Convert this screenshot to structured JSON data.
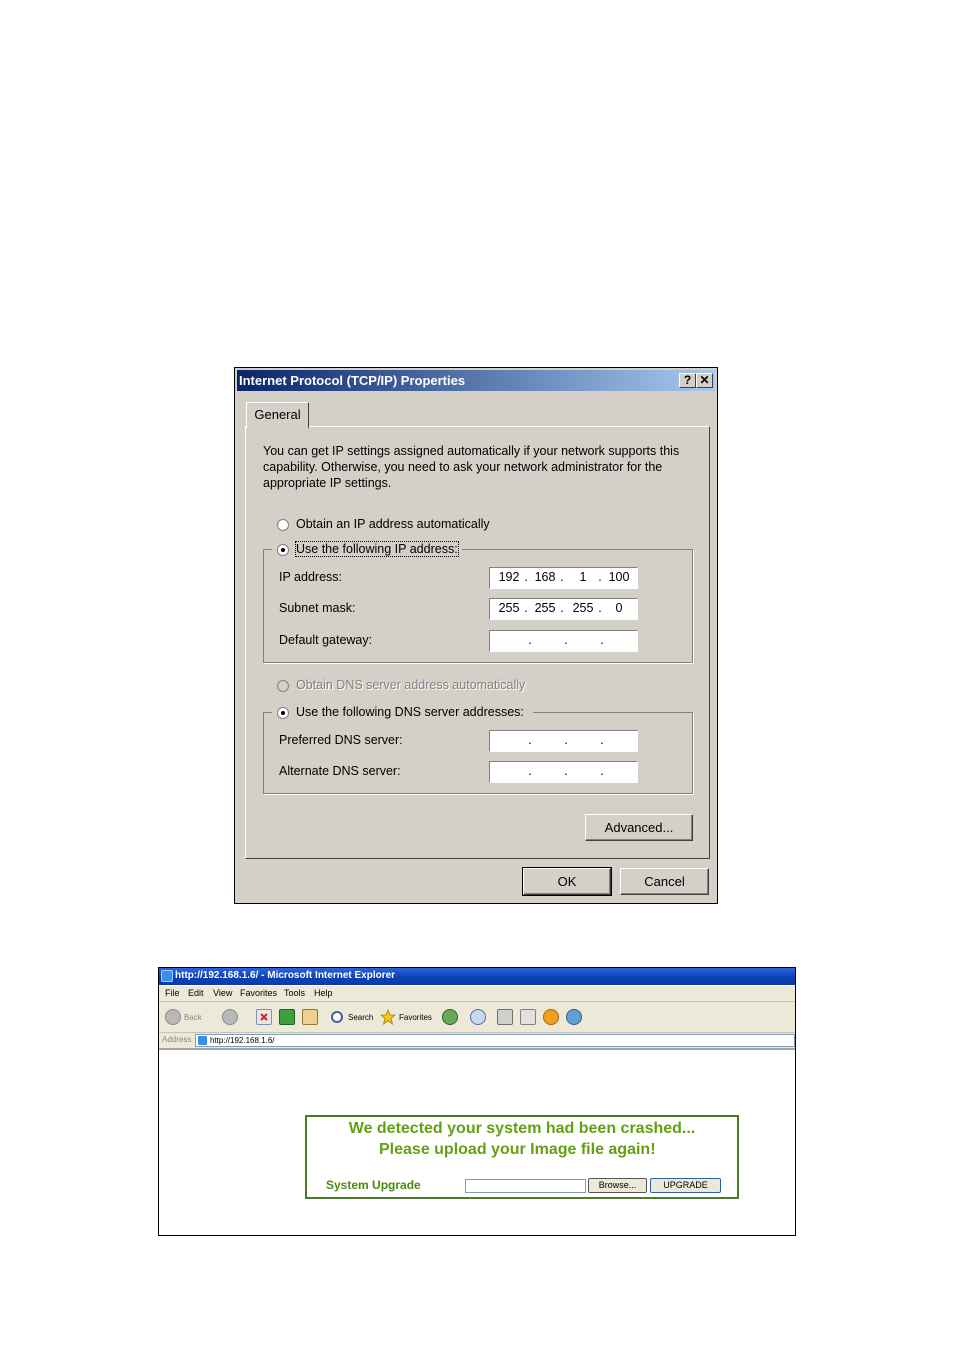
{
  "dialog": {
    "title": "Internet Protocol (TCP/IP) Properties",
    "help_button": "?",
    "close_button": "✕",
    "tab": "General",
    "intro": "You can get IP settings assigned automatically if your network supports this capability. Otherwise, you need to ask your network administrator for the appropriate IP settings.",
    "radio_obtain_ip": "Obtain an IP address automatically",
    "radio_use_ip": "Use the following IP address:",
    "ip_label": "IP address:",
    "ip_value": [
      "192",
      "168",
      "1",
      "100"
    ],
    "subnet_label": "Subnet mask:",
    "subnet_value": [
      "255",
      "255",
      "255",
      "0"
    ],
    "gateway_label": "Default gateway:",
    "radio_obtain_dns": "Obtain DNS server address automatically",
    "radio_use_dns": "Use the following DNS server addresses:",
    "preferred_dns_label": "Preferred DNS server:",
    "alternate_dns_label": "Alternate DNS server:",
    "octet_separator": ".",
    "advanced_button": "Advanced...",
    "ok_button": "OK",
    "cancel_button": "Cancel"
  },
  "browser": {
    "title": "http://192.168.1.6/ - Microsoft Internet Explorer",
    "menu": [
      "File",
      "Edit",
      "View",
      "Favorites",
      "Tools",
      "Help"
    ],
    "toolbar": {
      "back": "Back",
      "search": "Search",
      "favorites": "Favorites"
    },
    "address_label": "Address",
    "address_value": "http://192.168.1.6/",
    "page": {
      "line1": "We detected your system had been crashed...",
      "line2": "Please upload your Image file again!",
      "upgrade_label": "System Upgrade",
      "browse_button": "Browse...",
      "upgrade_button": "UPGRADE"
    }
  }
}
